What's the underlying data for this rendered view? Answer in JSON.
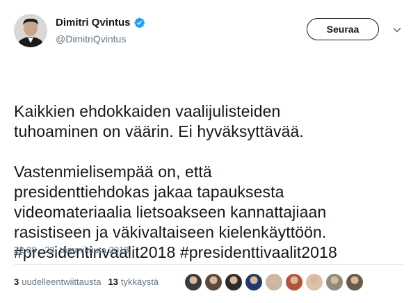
{
  "user": {
    "display_name": "Dimitri Qvintus",
    "handle": "@DimitriQvintus",
    "verified_icon": "verified-badge-icon"
  },
  "follow_label": "Seuraa",
  "menu_icon": "chevron-down-icon",
  "tweet": {
    "paragraph1": "Kaikkien ehdokkaiden vaalijulisteiden\ntuhoaminen on väärin. Ei hyväksyttävää.",
    "paragraph2": "Vastenmielisempää on, että\npresidenttiehdokas jakaa tapauksesta\nvideomateriaalia lietsoakseen kannattajiaan\nrasistiseen ja väkivaltaiseen kielenkäyttöön.",
    "hashtag1": "#presidentinvaalit2018",
    "hashtag2": "#presidenttivaalit2018"
  },
  "timestamp": "22.38 - 23. tammikuuta 2018",
  "stats": {
    "retweets_count": "3",
    "retweets_label": "uudelleentwiittausta",
    "likes_count": "13",
    "likes_label": "tykkäystä"
  },
  "liker_avatars": [
    {
      "name": "liker-avatar-1",
      "color": "#3a3a3a"
    },
    {
      "name": "liker-avatar-2",
      "color": "#5b4a3c"
    },
    {
      "name": "liker-avatar-3",
      "color": "#2c2c2c"
    },
    {
      "name": "liker-avatar-4",
      "color": "#1f3a6b"
    },
    {
      "name": "liker-avatar-5",
      "color": "#c9b7a3"
    },
    {
      "name": "liker-avatar-6",
      "color": "#b5523a"
    },
    {
      "name": "liker-avatar-7",
      "color": "#d9c2a8"
    },
    {
      "name": "liker-avatar-8",
      "color": "#8c8c7a"
    },
    {
      "name": "liker-avatar-9",
      "color": "#6a5a4a"
    }
  ],
  "colors": {
    "text": "#14171a",
    "secondary": "#657786",
    "verified": "#1da1f2",
    "divider": "#e6ecf0"
  }
}
